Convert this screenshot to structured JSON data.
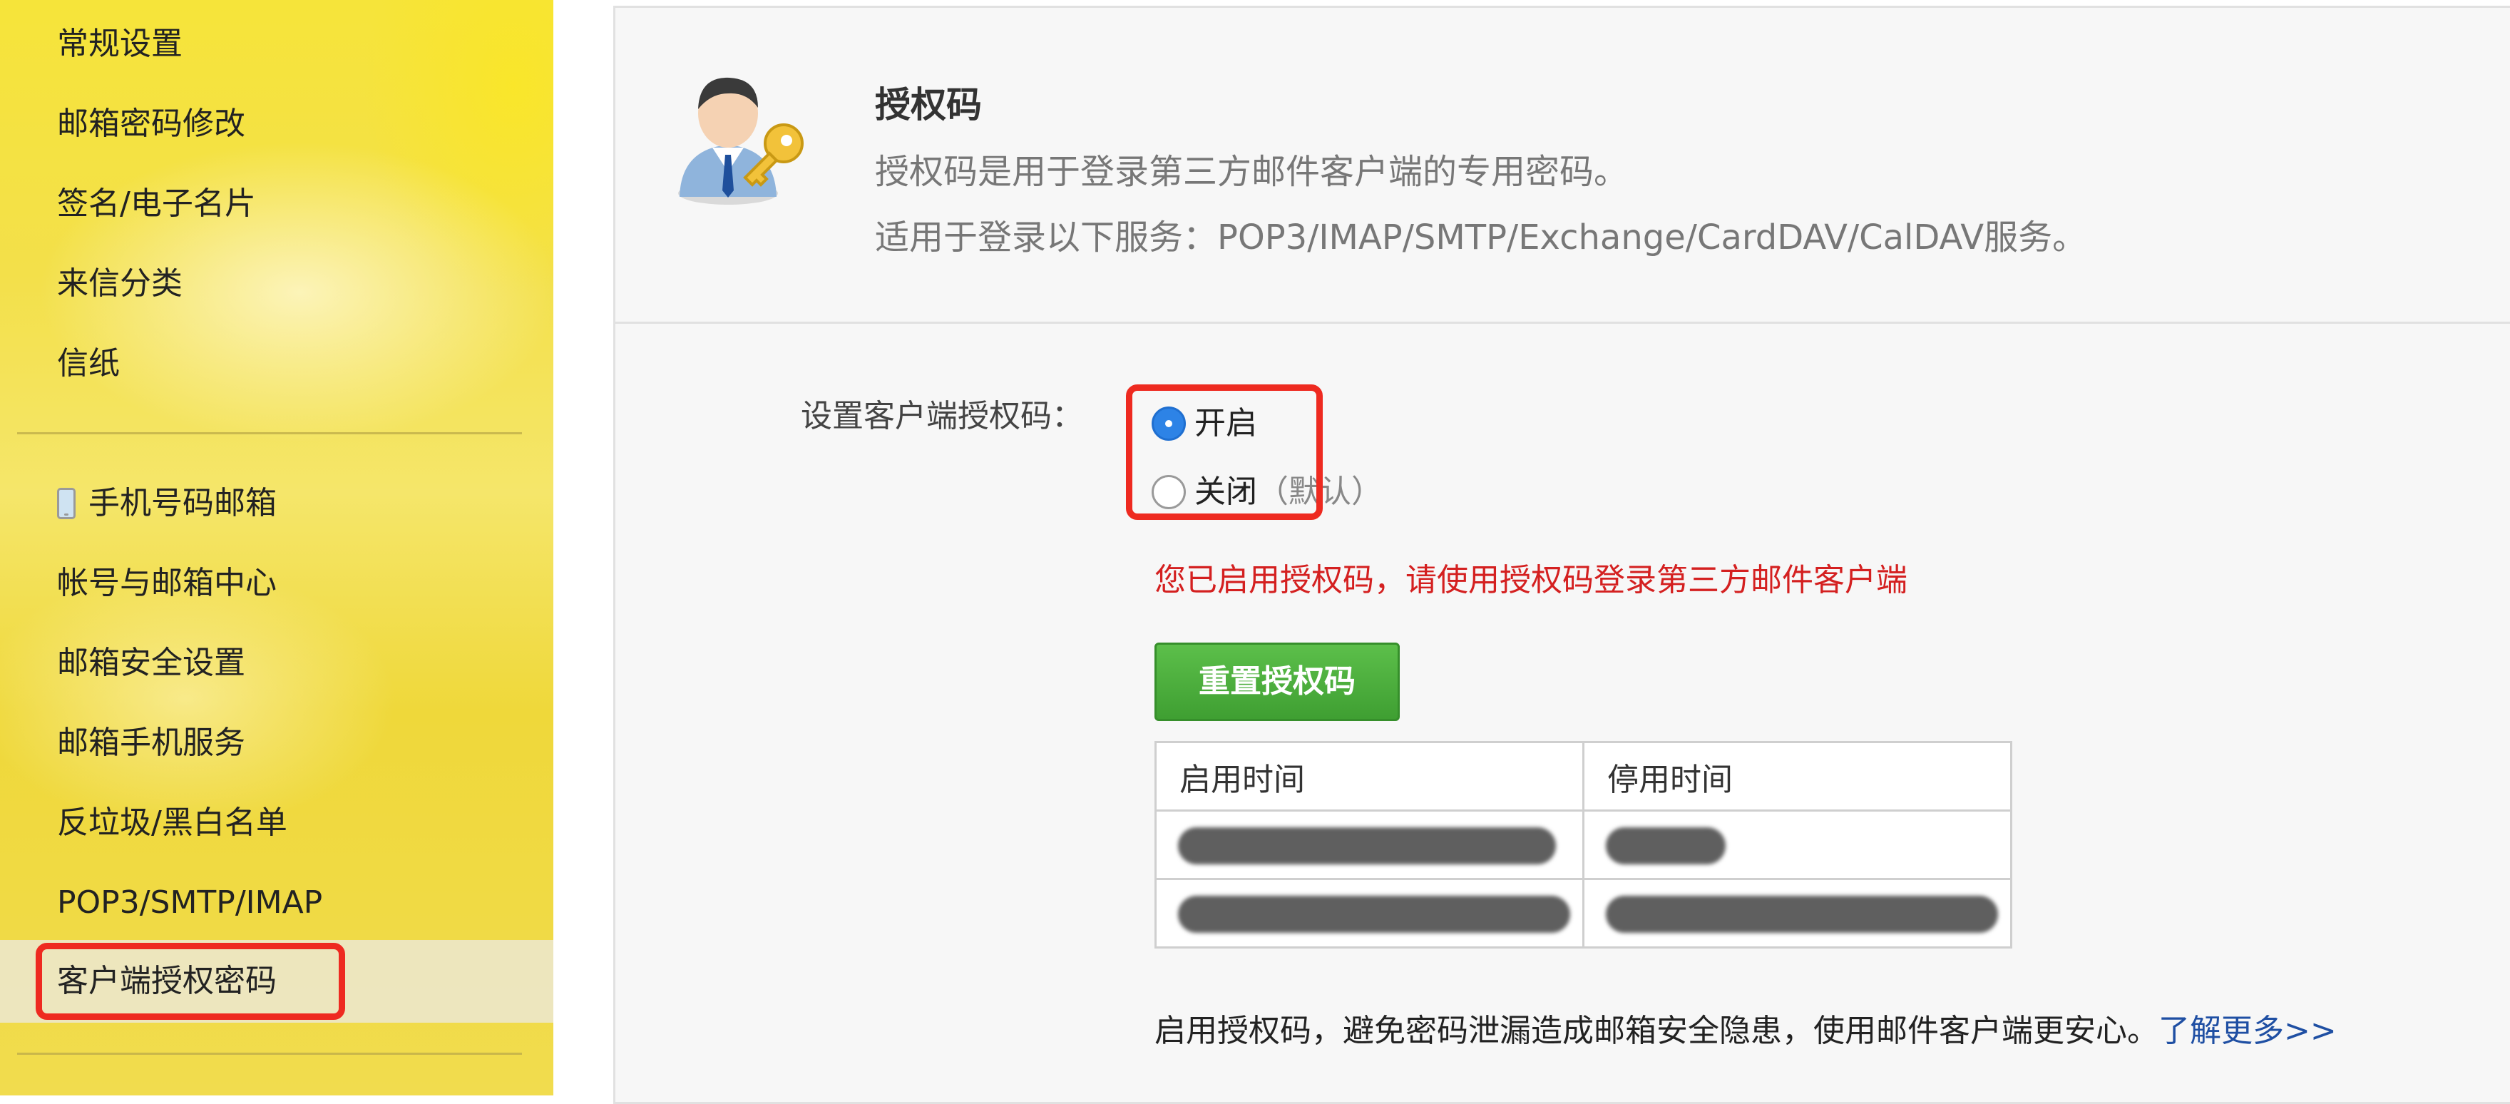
{
  "sidebar": {
    "items": [
      {
        "label": "常规设置"
      },
      {
        "label": "邮箱密码修改"
      },
      {
        "label": "签名/电子名片"
      },
      {
        "label": "来信分类"
      },
      {
        "label": "信纸"
      },
      {
        "label": "手机号码邮箱",
        "icon": "phone-icon"
      },
      {
        "label": "帐号与邮箱中心"
      },
      {
        "label": "邮箱安全设置"
      },
      {
        "label": "邮箱手机服务"
      },
      {
        "label": "反垃圾/黑白名单"
      },
      {
        "label": "POP3/SMTP/IMAP"
      },
      {
        "label": "客户端授权密码",
        "selected": true
      }
    ]
  },
  "header": {
    "title": "授权码",
    "desc1": "授权码是用于登录第三方邮件客户端的专用密码。",
    "desc2": "适用于登录以下服务：POP3/IMAP/SMTP/Exchange/CardDAV/CalDAV服务。"
  },
  "form": {
    "label": "设置客户端授权码：",
    "option_on": "开启",
    "option_off": "关闭",
    "option_off_note": "（默认）",
    "selected": "开启"
  },
  "status_message": "您已启用授权码，请使用授权码登录第三方邮件客户端",
  "reset_button": "重置授权码",
  "table": {
    "headers": [
      "启用时间",
      "停用时间"
    ]
  },
  "footer": {
    "text": "启用授权码，避免密码泄漏造成邮箱安全隐患，使用邮件客户端更安心。",
    "link": "了解更多>>"
  },
  "colors": {
    "sidebar_bg": "#f3e04a",
    "highlight_red": "#ee2a20",
    "button_green": "#4caf3d",
    "warning_red": "#d42020",
    "link_blue": "#1f4fa3",
    "radio_blue": "#2d83e6"
  }
}
